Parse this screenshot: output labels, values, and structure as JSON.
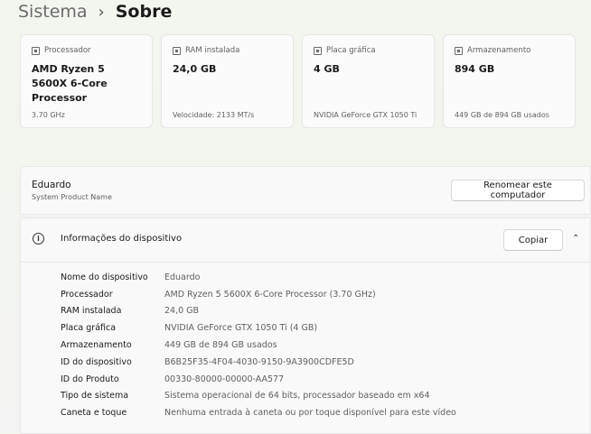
{
  "breadcrumb": {
    "parent": "Sistema",
    "separator": "›",
    "current": "Sobre"
  },
  "cards": [
    {
      "icon": "processor-icon",
      "title": "Processador",
      "value": "AMD Ryzen 5 5600X 6-Core Processor",
      "sub": "3.70 GHz"
    },
    {
      "icon": "ram-icon",
      "title": "RAM instalada",
      "value": "24,0 GB",
      "sub": "Velocidade: 2133 MT/s"
    },
    {
      "icon": "gpu-icon",
      "title": "Placa gráfica",
      "value": "4 GB",
      "sub": "NVIDIA GeForce GTX 1050 Ti"
    },
    {
      "icon": "storage-icon",
      "title": "Armazenamento",
      "value": "894 GB",
      "sub": "449 GB de 894 GB usados"
    }
  ],
  "device": {
    "name": "Eduardo",
    "model": "System Product Name",
    "rename_label": "Renomear este computador"
  },
  "info": {
    "icon": "info-icon",
    "title": "Informações do dispositivo",
    "copy_label": "Copiar",
    "chevron": "chevron-up-icon",
    "rows": [
      {
        "label": "Nome do dispositivo",
        "value": "Eduardo"
      },
      {
        "label": "Processador",
        "value": "AMD Ryzen 5 5600X 6-Core Processor (3.70 GHz)"
      },
      {
        "label": "RAM instalada",
        "value": "24,0 GB"
      },
      {
        "label": "Placa gráfica",
        "value": "NVIDIA GeForce GTX 1050 Ti (4 GB)"
      },
      {
        "label": "Armazenamento",
        "value": "449 GB de 894 GB usados"
      },
      {
        "label": "ID do dispositivo",
        "value": "B6B25F35-4F04-4030-9150-9A3900CDFE5D"
      },
      {
        "label": "ID do Produto",
        "value": "00330-80000-00000-AA577"
      },
      {
        "label": "Tipo de sistema",
        "value": "Sistema operacional de 64 bits, processador baseado em x64"
      },
      {
        "label": "Caneta e toque",
        "value": "Nenhuma entrada à caneta ou por toque disponível para este vídeo"
      }
    ]
  }
}
